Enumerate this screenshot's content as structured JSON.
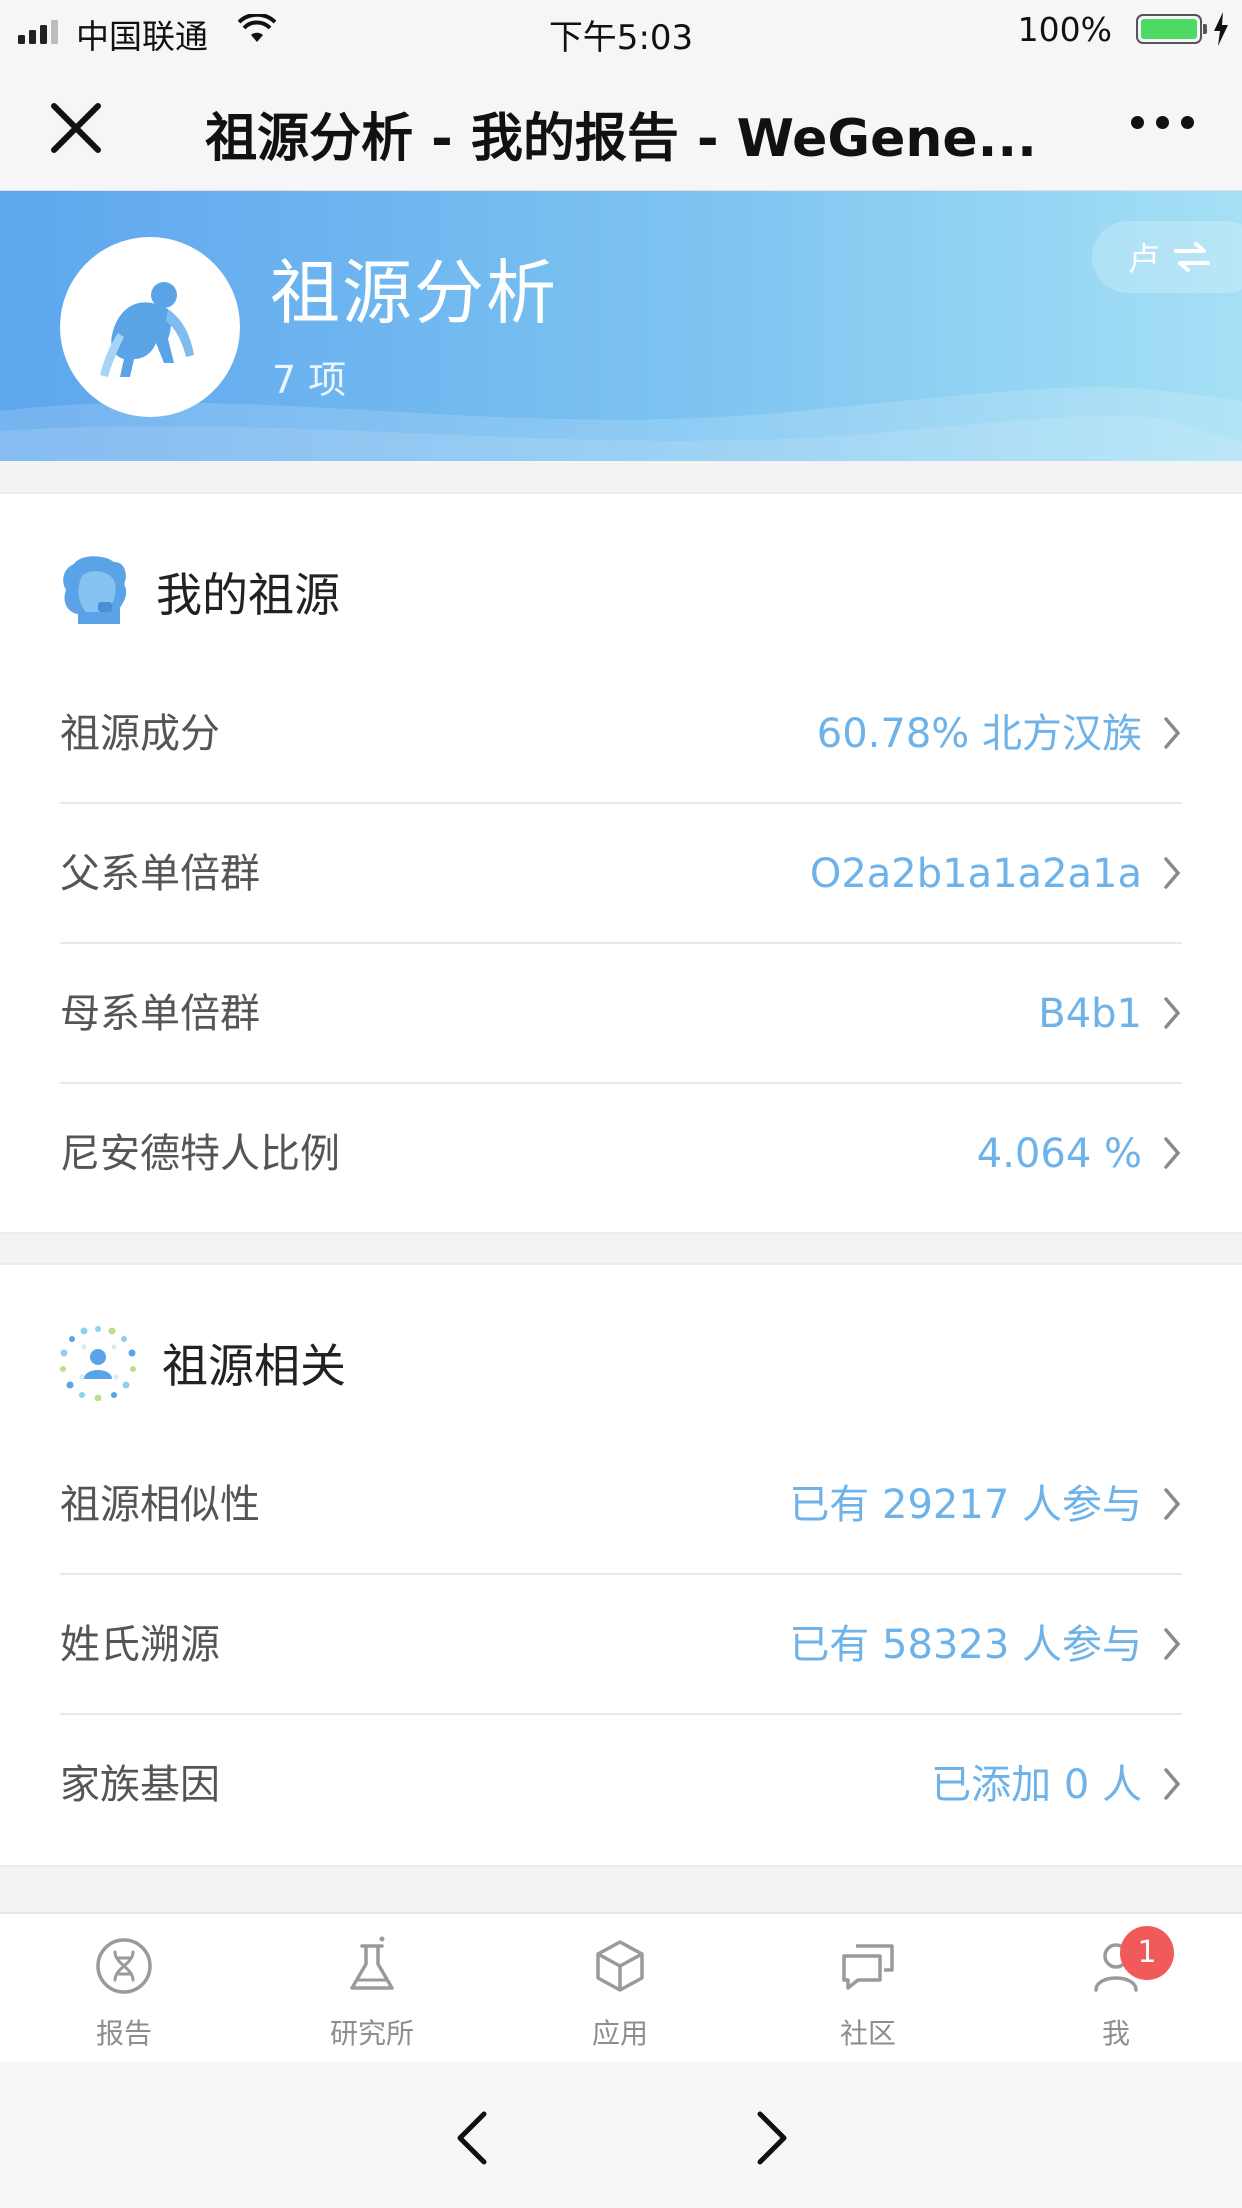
{
  "status": {
    "carrier": "中国联通",
    "time": "下午5:03",
    "battery": "100%"
  },
  "nav": {
    "title": "祖源分析 - 我的报告 - WeGene..."
  },
  "header": {
    "title": "祖源分析",
    "count": "7 项",
    "switch_label": "卢",
    "colors": {
      "gradient_start": "#5ea6ee",
      "gradient_end": "#a5e0f5"
    }
  },
  "sections": [
    {
      "title": "我的祖源",
      "icon": "face-avatar-icon",
      "rows": [
        {
          "label": "祖源成分",
          "value": "60.78% 北方汉族"
        },
        {
          "label": "父系单倍群",
          "value": "O2a2b1a1a2a1a"
        },
        {
          "label": "母系单倍群",
          "value": "B4b1"
        },
        {
          "label": "尼安德特人比例",
          "value": "4.064 %"
        }
      ]
    },
    {
      "title": "祖源相关",
      "icon": "people-network-icon",
      "rows": [
        {
          "label": "祖源相似性",
          "value": "已有 29217 人参与"
        },
        {
          "label": "姓氏溯源",
          "value": "已有 58323 人参与"
        },
        {
          "label": "家族基因",
          "value": "已添加 0 人"
        }
      ]
    }
  ],
  "tabs": [
    {
      "label": "报告",
      "icon": "dna-icon"
    },
    {
      "label": "研究所",
      "icon": "flask-icon"
    },
    {
      "label": "应用",
      "icon": "cube-icon"
    },
    {
      "label": "社区",
      "icon": "chat-bubbles-icon"
    },
    {
      "label": "我",
      "icon": "person-icon",
      "badge": "1"
    }
  ],
  "accent_color": "#6eb2ea"
}
